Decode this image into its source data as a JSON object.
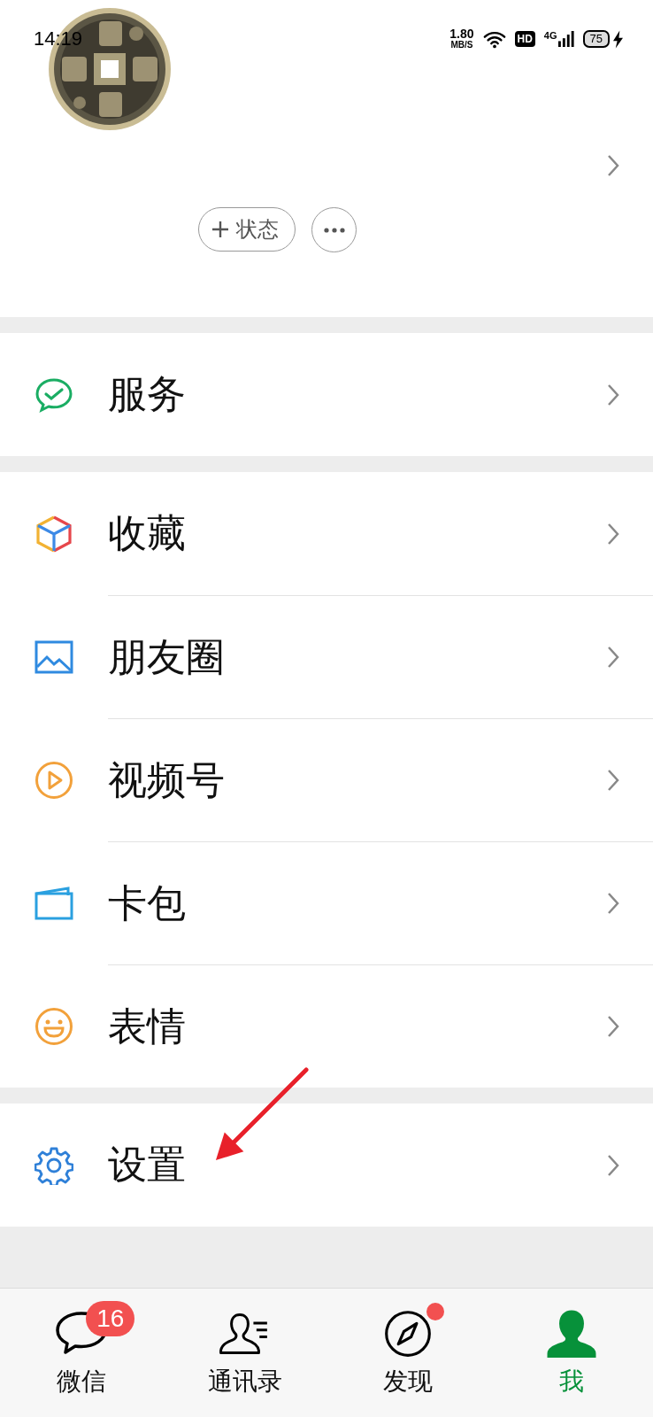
{
  "status_bar": {
    "time": "14:19",
    "speed": "1.80",
    "speed_unit": "MB/S",
    "hd": "HD",
    "network": "4G",
    "battery": "75",
    "charging": true
  },
  "profile": {
    "status_button": "状态"
  },
  "menu_groups": [
    [
      {
        "kind": "service",
        "label": "服务"
      }
    ],
    [
      {
        "kind": "favorites",
        "label": "收藏"
      },
      {
        "kind": "moments",
        "label": "朋友圈"
      },
      {
        "kind": "channels",
        "label": "视频号"
      },
      {
        "kind": "cards",
        "label": "卡包"
      },
      {
        "kind": "stickers",
        "label": "表情"
      }
    ],
    [
      {
        "kind": "settings",
        "label": "设置"
      }
    ]
  ],
  "tabs": [
    {
      "kind": "chats",
      "label": "微信",
      "selected": false,
      "badge": "16",
      "dot": false
    },
    {
      "kind": "contacts",
      "label": "通讯录",
      "selected": false,
      "dot": false
    },
    {
      "kind": "discover",
      "label": "发现",
      "selected": false,
      "dot": true
    },
    {
      "kind": "me",
      "label": "我",
      "selected": true,
      "dot": false
    }
  ]
}
